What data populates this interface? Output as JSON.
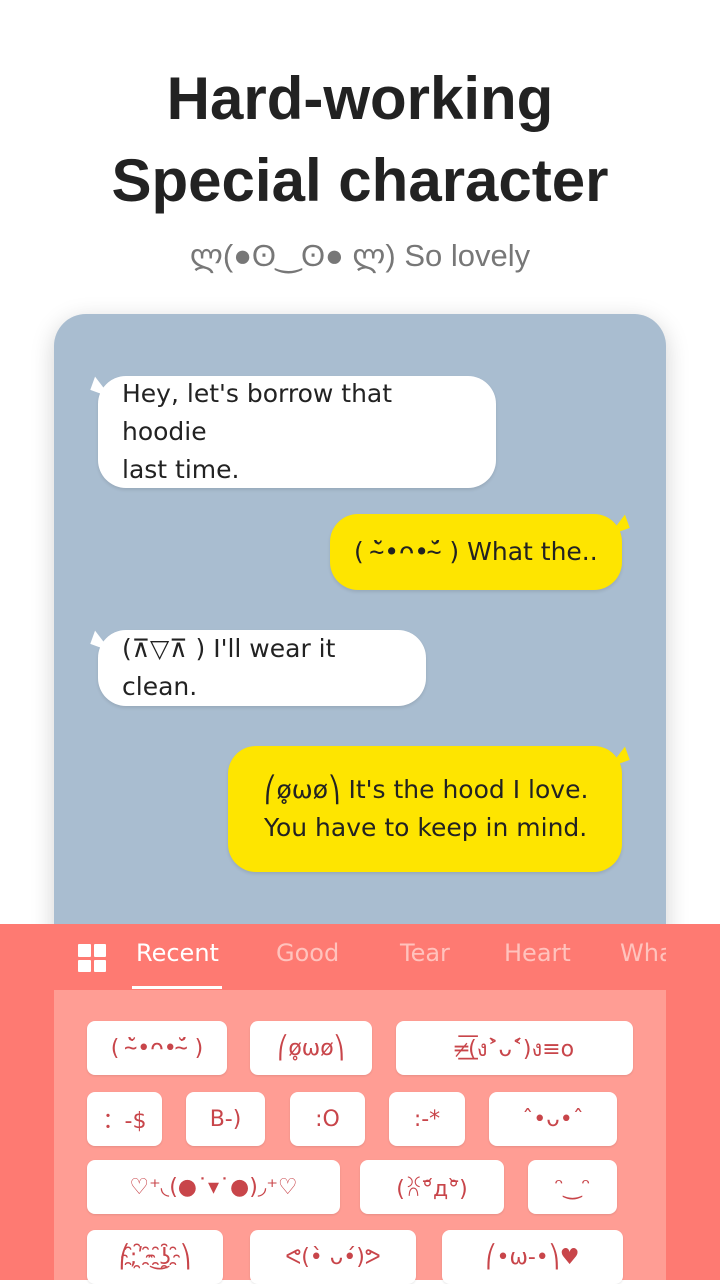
{
  "header": {
    "title_line1": "Hard-working",
    "title_line2": "Special character",
    "subtitle": "ლ(●ʘ‿ʘ● ლ) So lovely"
  },
  "chat": {
    "messages": [
      {
        "side": "left",
        "text_line1": "Hey, let's borrow that hoodie",
        "text_line2": "last time."
      },
      {
        "side": "right",
        "text": "( ˘̴̀•ᴖ•˘̴́ )  What the.."
      },
      {
        "side": "left",
        "text": "(⊼▽⊼ ) I'll wear it clean."
      },
      {
        "side": "right",
        "text_line1": "⎛ø̥ωø⎞ It's the hood I love.",
        "text_line2": "You have to keep in mind."
      }
    ]
  },
  "keyboard": {
    "grid_icon": "grid-icon",
    "tabs": [
      "Recent",
      "Good",
      "Tear",
      "Heart",
      "What"
    ],
    "active_tab": "Recent",
    "items": [
      "( ˘̴̀•ᴖ•˘̴́ )",
      "⎛ø̥ωø⎞",
      "═̷͟͟͞(ง˃̀ᴗ˂́)ง≡ο",
      "：-$",
      "B-)",
      ":O",
      ":-*",
      "ˆ•ᴗ•ˆ",
      "♡⁺◟(●˙▾˙●)◞⁺♡",
      "(ꐦ°᷄д°᷅)",
      "ᵔ‿ᵔ",
      "⎛;ʹ҈ ͜ʖ҈⎞",
      "ᕙ(•̀ ᴗ•́)ᕗ",
      "⎛•ω-•⎞♥"
    ]
  },
  "colors": {
    "chat_bg": "#a9bdd0",
    "bubble_mine": "#fee500",
    "keyboard_tabs": "#fe7a72",
    "keyboard_body": "#ff9d94",
    "chip_text": "#c8454a"
  }
}
